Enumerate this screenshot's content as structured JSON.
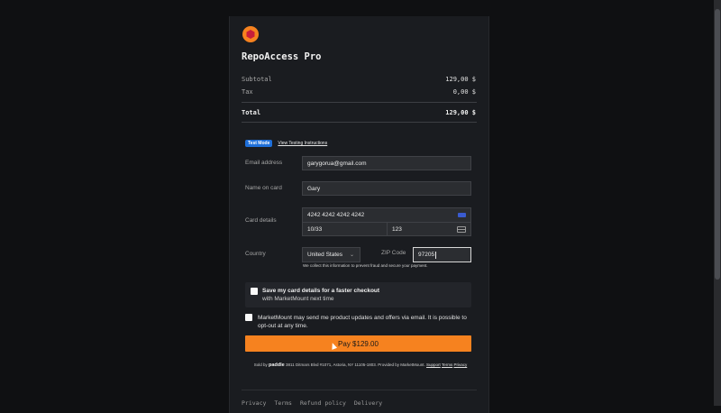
{
  "product": {
    "title": "RepoAccess Pro"
  },
  "summary": {
    "subtotal_label": "Subtotal",
    "subtotal_value": "129,00 $",
    "tax_label": "Tax",
    "tax_value": "0,00 $",
    "total_label": "Total",
    "total_value": "129,00 $"
  },
  "test_mode": {
    "badge": "Test Mode",
    "link": "View Testing Instructions"
  },
  "form": {
    "email_label": "Email address",
    "email_value": "garygorua@gmail.com",
    "name_label": "Name on card",
    "name_value": "Gary",
    "card_label": "Card details",
    "card_number": "4242 4242 4242 4242",
    "expiry": "10/33",
    "cvc": "123",
    "country_label": "Country",
    "country_value": "United States",
    "zip_label": "ZIP Code",
    "zip_value": "97205",
    "privacy_note": "We collect this information to prevent fraud and secure your payment."
  },
  "save_card": {
    "title": "Save my card details for a faster checkout",
    "subtitle": "with MarketMount next time"
  },
  "consent": {
    "text": "MarketMount may send me product updates and offers via email. It is possible to opt-out at any time."
  },
  "pay_button": {
    "label": "Pay $129.00"
  },
  "sold_by": {
    "prefix": "Sold by",
    "brand": "paddle",
    "address": "3811 Ditmars Blvd #1071, Astoria, NY 11105-1803. Provided by MarketMount.",
    "support": "Support",
    "terms": "Terms",
    "privacy": "Privacy"
  },
  "footer": {
    "links": [
      "Privacy",
      "Terms",
      "Refund policy",
      "Delivery"
    ]
  },
  "colors": {
    "accent": "#f6821f",
    "badge": "#1e6fd9",
    "panel": "#1a1c20",
    "page": "#0f1012"
  },
  "icons": {
    "logo": "hexagon-logo-icon",
    "card_brand": "card-brand-icon",
    "cvc": "cvc-card-icon",
    "select": "chevron-down-icon"
  }
}
